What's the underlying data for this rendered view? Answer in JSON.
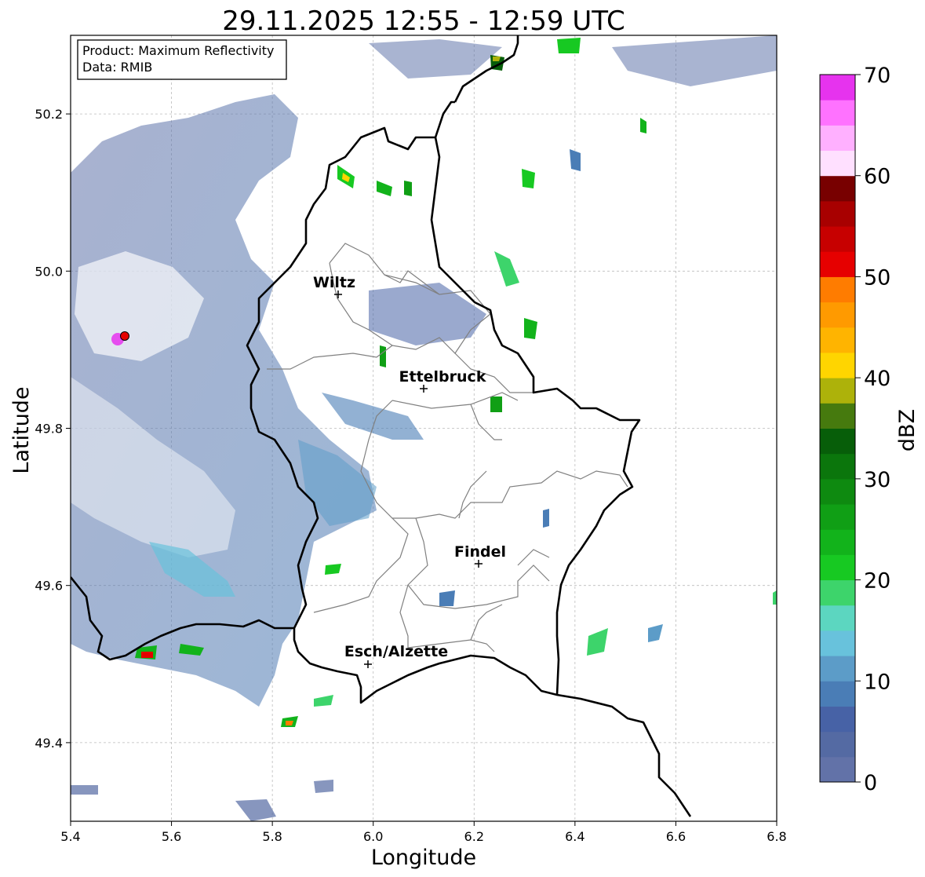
{
  "title": "29.11.2025 12:55 - 12:59 UTC",
  "info": {
    "product_line": "Product: Maximum Reflectivity",
    "data_line": "Data: RMIB"
  },
  "axes": {
    "xlabel": "Longitude",
    "ylabel": "Latitude",
    "xlim": [
      5.4,
      6.8
    ],
    "ylim": [
      49.3,
      50.3
    ],
    "xticks": [
      "5.4",
      "5.6",
      "5.8",
      "6.0",
      "6.2",
      "6.4",
      "6.6",
      "6.8"
    ],
    "yticks": [
      "49.4",
      "49.6",
      "49.8",
      "50.0",
      "50.2"
    ],
    "grid": true
  },
  "colorbar": {
    "label": "dBZ",
    "range": [
      0,
      70
    ],
    "ticks": [
      "0",
      "10",
      "20",
      "30",
      "40",
      "50",
      "60",
      "70"
    ],
    "colors": [
      "#6272a8",
      "#546aa3",
      "#4762a6",
      "#4a7db6",
      "#5c9cc8",
      "#68c2dc",
      "#5cd6c0",
      "#3dd46b",
      "#17c922",
      "#12b31b",
      "#109f15",
      "#0e8a10",
      "#0b760c",
      "#075e09",
      "#467a0e",
      "#adb20a",
      "#ffd500",
      "#ffb400",
      "#ff9a00",
      "#ff7c00",
      "#e60000",
      "#c70000",
      "#a80000",
      "#780000",
      "#ffe0ff",
      "#ffb0ff",
      "#ff72ff",
      "#e633ee"
    ]
  },
  "cities": [
    {
      "name": "Wiltz",
      "lon": 5.93,
      "lat": 49.97
    },
    {
      "name": "Ettelbruck",
      "lon": 6.1,
      "lat": 49.85
    },
    {
      "name": "Findel",
      "lon": 6.21,
      "lat": 49.63
    },
    {
      "name": "Esch/Alzette",
      "lon": 5.99,
      "lat": 49.5
    }
  ],
  "radar_site": {
    "lon": 5.505,
    "lat": 49.918,
    "color": "#e60000"
  },
  "colors": {
    "border": "#000000",
    "district": "#808080",
    "grid": "#bbbbbb"
  }
}
